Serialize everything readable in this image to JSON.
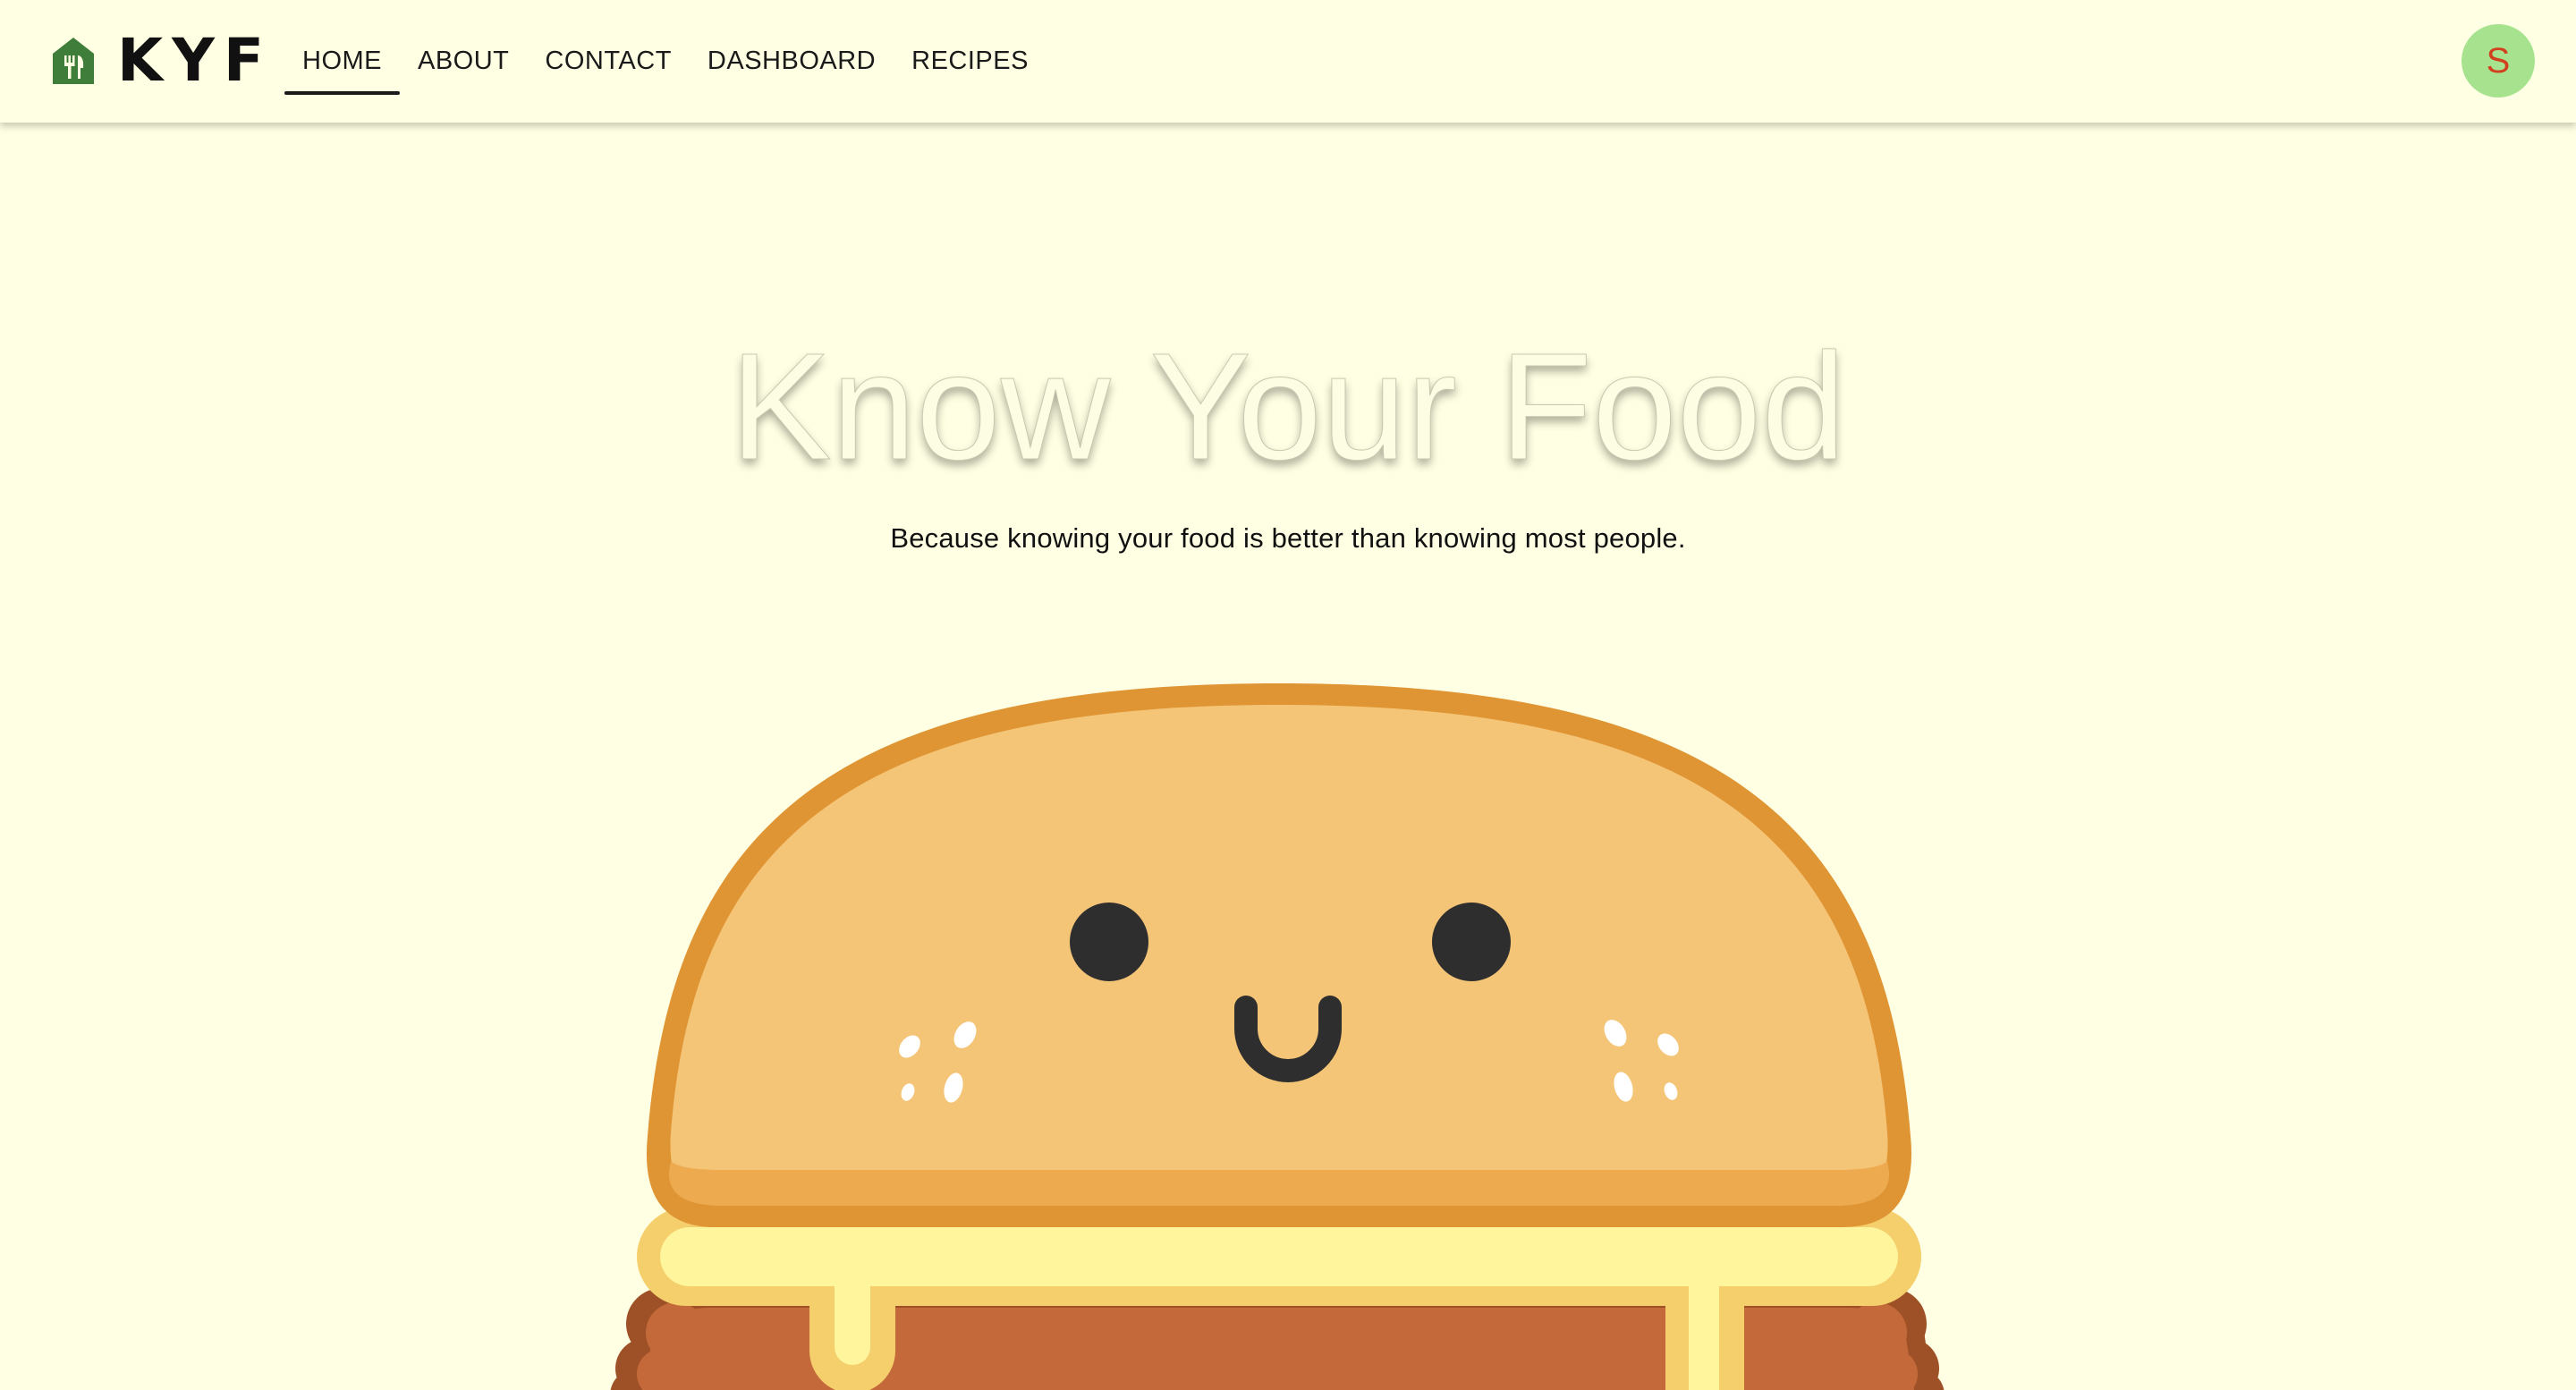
{
  "brand": {
    "name": "KYF",
    "icon": "home-fork-knife-icon",
    "icon_color": "#3e7d3a"
  },
  "nav": {
    "items": [
      {
        "label": "HOME",
        "active": true
      },
      {
        "label": "ABOUT",
        "active": false
      },
      {
        "label": "CONTACT",
        "active": false
      },
      {
        "label": "DASHBOARD",
        "active": false
      },
      {
        "label": "RECIPES",
        "active": false
      }
    ]
  },
  "user": {
    "initial": "S",
    "avatar_bg": "#a7e28f",
    "initial_color": "#d2401d"
  },
  "hero": {
    "title": "Know Your Food",
    "subtitle": "Because knowing your food is better than knowing most people.",
    "illustration": "smiling-burger-illustration"
  },
  "colors": {
    "background": "#ffffe3",
    "bun": "#f5c577",
    "bun_outline": "#e09535",
    "cheese": "#fff59d",
    "patty": "#c46a3a"
  }
}
